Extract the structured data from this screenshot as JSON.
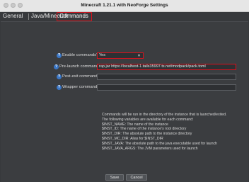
{
  "window": {
    "title": "Minecraft 1.21.1 with NeoForge Settings"
  },
  "tabs": [
    {
      "label": "General"
    },
    {
      "label": "Java/Minecraft"
    },
    {
      "label": "Commands"
    }
  ],
  "form": {
    "enable_commands": {
      "label": "Enable commands?",
      "value": "Yes"
    },
    "pre_launch": {
      "label": "Pre-launch command:",
      "value": "rap.jar https://localhost-1.tails35997.ts.net/modpack/pack.toml"
    },
    "post_exit": {
      "label": "Post-exit command:",
      "value": ""
    },
    "wrapper": {
      "label": "Wrapper command:",
      "value": ""
    }
  },
  "help_lines": [
    "Commands will be run in the directory of the instance that is launched/exited.",
    "The following variables are available for each command:",
    "$INST_NAME: The name of the instance",
    "$INST_ID: The name of the instance's root directory",
    "$INST_DIR: The absolute path to the instance directory",
    "$INST_MC_DIR: Alias for $INST_DIR",
    "$INST_JAVA: The absolute path to the java executable used for launch",
    "$INST_JAVA_ARGS: The JVM parameters used for launch"
  ],
  "buttons": {
    "save": "Save",
    "cancel": "Cancel"
  },
  "colors": {
    "highlight": "#d6121d",
    "help_icon": "#3b78c8"
  }
}
